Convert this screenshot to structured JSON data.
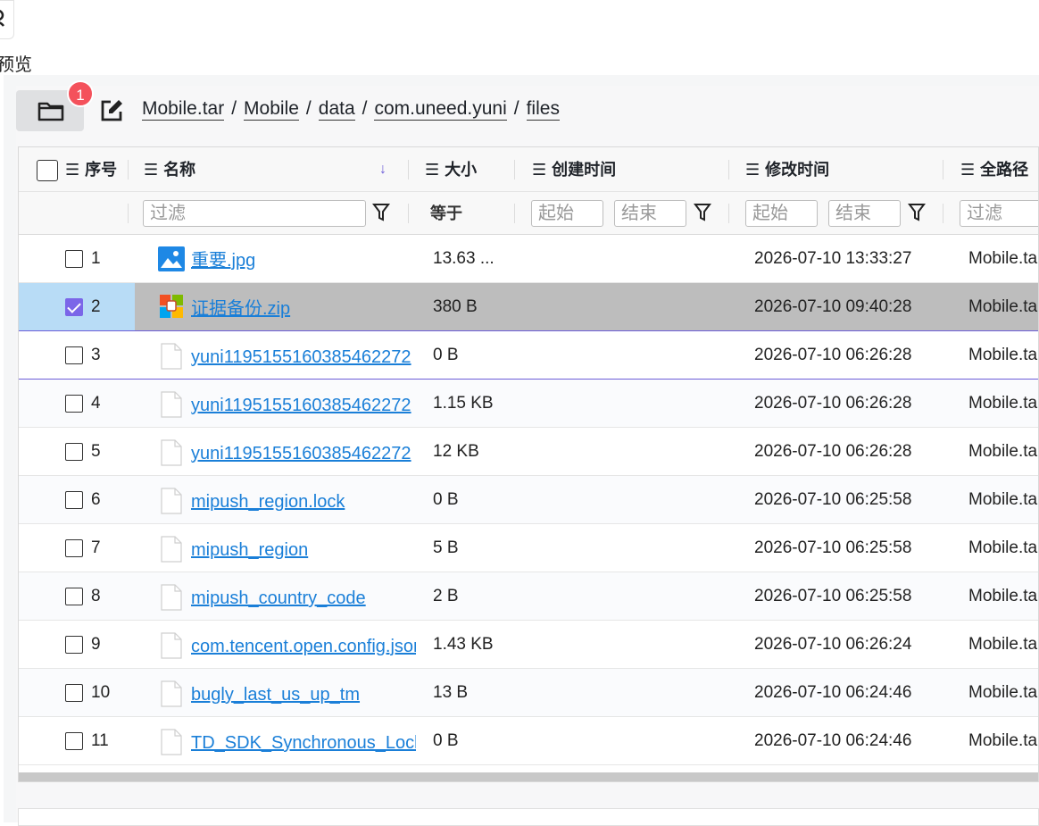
{
  "top": {
    "preview_label": "预览"
  },
  "toolbar": {
    "badge_count": "1",
    "breadcrumb": [
      "Mobile.tar",
      "Mobile",
      "data",
      "com.uneed.yuni",
      "files"
    ]
  },
  "columns": {
    "index": "序号",
    "name": "名称",
    "size": "大小",
    "created": "创建时间",
    "modified": "修改时间",
    "fullpath": "全路径"
  },
  "filters": {
    "name_placeholder": "过滤",
    "size_label": "等于",
    "created_start": "起始",
    "created_end": "结束",
    "modified_start": "起始",
    "modified_end": "结束",
    "path_placeholder": "过滤"
  },
  "rows": [
    {
      "idx": "1",
      "name": "重要.jpg",
      "size": "13.63 ...",
      "created": "",
      "modified": "2026-07-10 13:33:27",
      "path": "Mobile.ta",
      "icon": "image-icon",
      "checked": false
    },
    {
      "idx": "2",
      "name": "证据备份.zip",
      "size": "380 B",
      "created": "",
      "modified": "2026-07-10 09:40:28",
      "path": "Mobile.ta",
      "icon": "zip-icon",
      "checked": true
    },
    {
      "idx": "3",
      "name": "yuni1195155160385462272",
      "size": "0 B",
      "created": "",
      "modified": "2026-07-10 06:26:28",
      "path": "Mobile.ta",
      "icon": "file-icon",
      "checked": false
    },
    {
      "idx": "4",
      "name": "yuni1195155160385462272",
      "size": "1.15 KB",
      "created": "",
      "modified": "2026-07-10 06:26:28",
      "path": "Mobile.ta",
      "icon": "file-icon",
      "checked": false
    },
    {
      "idx": "5",
      "name": "yuni1195155160385462272",
      "size": "12 KB",
      "created": "",
      "modified": "2026-07-10 06:26:28",
      "path": "Mobile.ta",
      "icon": "file-icon",
      "checked": false
    },
    {
      "idx": "6",
      "name": "mipush_region.lock",
      "size": "0 B",
      "created": "",
      "modified": "2026-07-10 06:25:58",
      "path": "Mobile.ta",
      "icon": "file-icon",
      "checked": false
    },
    {
      "idx": "7",
      "name": "mipush_region",
      "size": "5 B",
      "created": "",
      "modified": "2026-07-10 06:25:58",
      "path": "Mobile.ta",
      "icon": "file-icon",
      "checked": false
    },
    {
      "idx": "8",
      "name": "mipush_country_code",
      "size": "2 B",
      "created": "",
      "modified": "2026-07-10 06:25:58",
      "path": "Mobile.ta",
      "icon": "file-icon",
      "checked": false
    },
    {
      "idx": "9",
      "name": "com.tencent.open.config.json",
      "size": "1.43 KB",
      "created": "",
      "modified": "2026-07-10 06:26:24",
      "path": "Mobile.ta",
      "icon": "file-icon",
      "checked": false
    },
    {
      "idx": "10",
      "name": "bugly_last_us_up_tm",
      "size": "13 B",
      "created": "",
      "modified": "2026-07-10 06:24:46",
      "path": "Mobile.ta",
      "icon": "file-icon",
      "checked": false
    },
    {
      "idx": "11",
      "name": "TD_SDK_Synchronous_Lock",
      "size": "0 B",
      "created": "",
      "modified": "2026-07-10 06:24:46",
      "path": "Mobile.ta",
      "icon": "file-icon",
      "checked": false
    }
  ],
  "colors": {
    "accent": "#7b66e8",
    "link": "#1a7fd8",
    "badge": "#f4515b",
    "selected_row": "#bdbdbd",
    "selected_check_cell": "#b8dcf6"
  }
}
